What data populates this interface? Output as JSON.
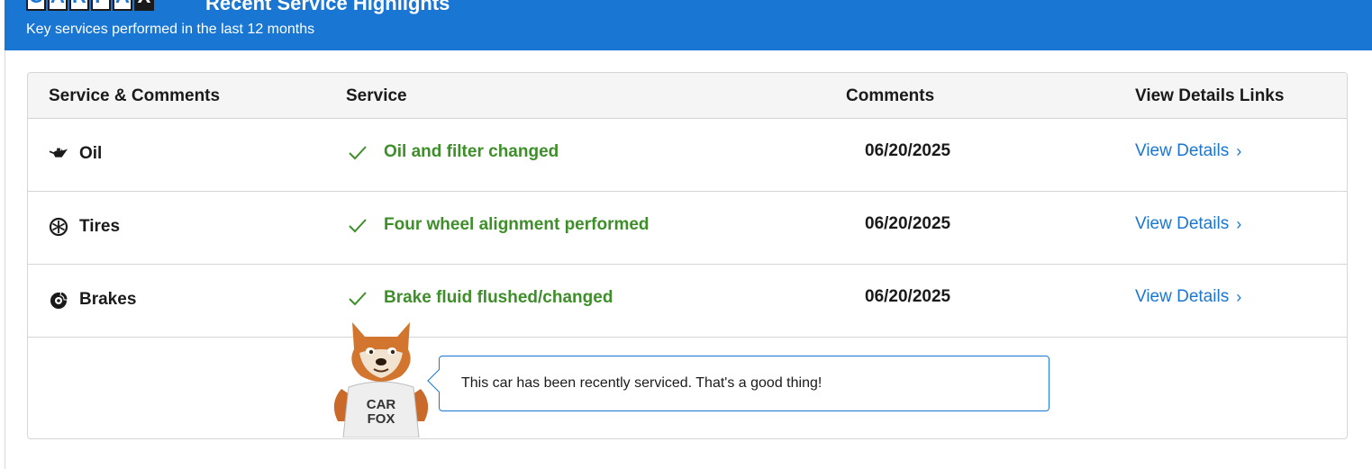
{
  "header": {
    "logo_letters": [
      "C",
      "A",
      "R",
      "F",
      "A",
      "X"
    ],
    "title": "Recent Service Highlights",
    "subtitle": "Key services performed in the last 12 months"
  },
  "table": {
    "columns": [
      "Service & Comments",
      "Service",
      "Comments",
      "View Details Links"
    ],
    "rows": [
      {
        "icon": "oil-can-icon",
        "category": "Oil",
        "service": "Oil and filter changed",
        "date": "06/20/2025",
        "link": "View Details"
      },
      {
        "icon": "tire-icon",
        "category": "Tires",
        "service": "Four wheel alignment performed",
        "date": "06/20/2025",
        "link": "View Details"
      },
      {
        "icon": "brake-disc-icon",
        "category": "Brakes",
        "service": "Brake fluid flushed/changed",
        "date": "06/20/2025",
        "link": "View Details"
      }
    ]
  },
  "promo": {
    "mascot_shirt": [
      "CAR",
      "FOX"
    ],
    "message": "This car has been recently serviced. That's a good thing!"
  },
  "colors": {
    "brand_blue": "#1976d2",
    "success_green": "#3e8e2a"
  }
}
